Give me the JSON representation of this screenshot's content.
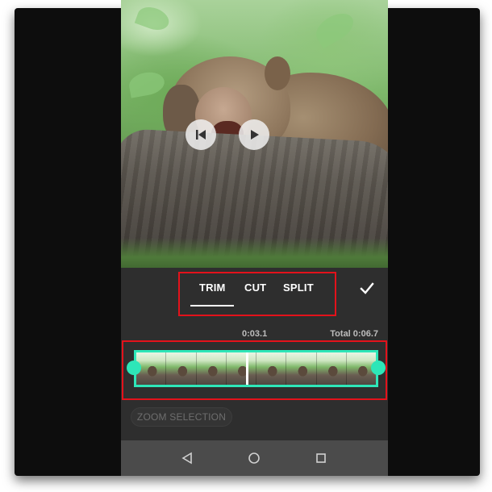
{
  "editor": {
    "tabs": [
      {
        "label": "TRIM",
        "active": true
      },
      {
        "label": "CUT",
        "active": false
      },
      {
        "label": "SPLIT",
        "active": false
      }
    ],
    "confirm_icon": "check-icon"
  },
  "timeline": {
    "current_time": "0:03.1",
    "total_time": "Total 0:06.7",
    "frame_count": 8
  },
  "zoom": {
    "label": "ZOOM SELECTION"
  },
  "player": {
    "rewind_icon": "skip-previous-icon",
    "play_icon": "play-icon"
  },
  "navbar": {
    "back_icon": "back-triangle-icon",
    "home_icon": "home-circle-icon",
    "recents_icon": "recents-square-icon"
  },
  "colors": {
    "accent": "#2ee6b8",
    "highlight_border": "#e3121b",
    "panel_bg": "#2e2e2e",
    "navbar_bg": "#4b4b4b"
  }
}
